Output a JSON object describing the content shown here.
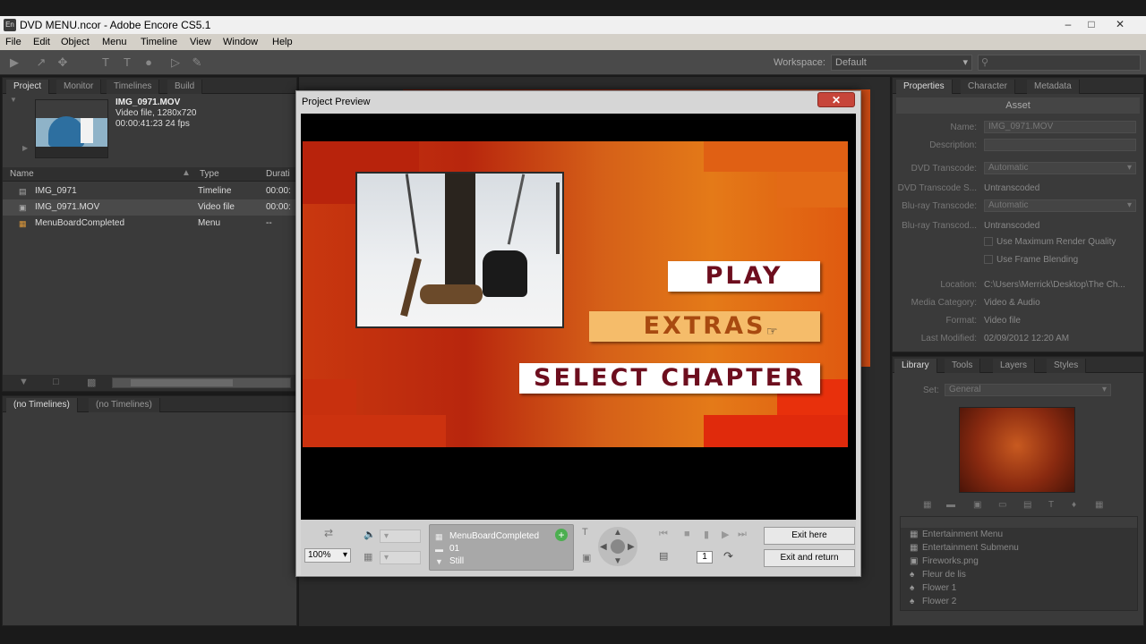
{
  "window": {
    "title": "DVD MENU.ncor - Adobe Encore CS5.1",
    "app_icon": "En"
  },
  "menubar": [
    "File",
    "Edit",
    "Object",
    "Menu",
    "Timeline",
    "View",
    "Window",
    "Help"
  ],
  "toolbar": {
    "workspace_label": "Workspace:",
    "workspace_value": "Default"
  },
  "project_panel": {
    "tabs": [
      "Project",
      "Monitor",
      "Timelines",
      "Build"
    ],
    "asset": {
      "name": "IMG_0971.MOV",
      "line2": "Video file, 1280x720",
      "line3": "00:00:41:23 24 fps"
    },
    "columns": [
      "Name",
      "Type",
      "Durati"
    ],
    "rows": [
      {
        "name": "IMG_0971",
        "type": "Timeline",
        "duration": "00:00:",
        "icon": "timeline-icon"
      },
      {
        "name": "IMG_0971.MOV",
        "type": "Video file",
        "duration": "00:00:",
        "icon": "video-file-icon"
      },
      {
        "name": "MenuBoardCompleted",
        "type": "Menu",
        "duration": "--",
        "icon": "menu-icon"
      }
    ]
  },
  "timeline_panel": {
    "tabs": [
      "(no Timelines)",
      "(no Timelines)"
    ]
  },
  "properties_panel": {
    "tabs": [
      "Properties",
      "Character",
      "Metadata"
    ],
    "header": "Asset",
    "fields": [
      {
        "label": "Name:",
        "value": "IMG_0971.MOV",
        "kind": "box"
      },
      {
        "label": "Description:",
        "value": "",
        "kind": "box"
      },
      {
        "label": "DVD Transcode:",
        "value": "Automatic",
        "kind": "select"
      },
      {
        "label": "DVD Transcode S...",
        "value": "Untranscoded",
        "kind": "text"
      },
      {
        "label": "Blu-ray Transcode:",
        "value": "Automatic",
        "kind": "select"
      },
      {
        "label": "Blu-ray Transcod...",
        "value": "Untranscoded",
        "kind": "text"
      }
    ],
    "checkboxes": [
      "Use Maximum Render Quality",
      "Use Frame Blending"
    ],
    "info": [
      {
        "label": "Location:",
        "value": "C:\\Users\\Merrick\\Desktop\\The Ch..."
      },
      {
        "label": "Media Category:",
        "value": "Video & Audio"
      },
      {
        "label": "Format:",
        "value": "Video file"
      },
      {
        "label": "Last Modified:",
        "value": "02/09/2012 12:20 AM"
      }
    ]
  },
  "library_panel": {
    "tabs": [
      "Library",
      "Tools",
      "Layers",
      "Styles"
    ],
    "set_label": "Set:",
    "set_value": "General",
    "items": [
      {
        "label": "Entertainment Menu",
        "icon": "menu-icon"
      },
      {
        "label": "Entertainment Submenu",
        "icon": "menu-icon"
      },
      {
        "label": "Fireworks.png",
        "icon": "image-icon"
      },
      {
        "label": "Fleur de lis",
        "icon": "shape-icon"
      },
      {
        "label": "Flower 1",
        "icon": "shape-icon"
      },
      {
        "label": "Flower 2",
        "icon": "shape-icon"
      }
    ]
  },
  "dialog": {
    "title": "Project Preview",
    "close": "✕",
    "menu_buttons": {
      "play": "PLAY",
      "extras": "EXTRAS",
      "chapter": "SELECT CHAPTER"
    },
    "zoom": "100%",
    "status": {
      "menu": "MenuBoardCompleted",
      "button": "01",
      "mode": "Still"
    },
    "chapter_number": "1",
    "exit_here": "Exit here",
    "exit_return": "Exit and return"
  }
}
